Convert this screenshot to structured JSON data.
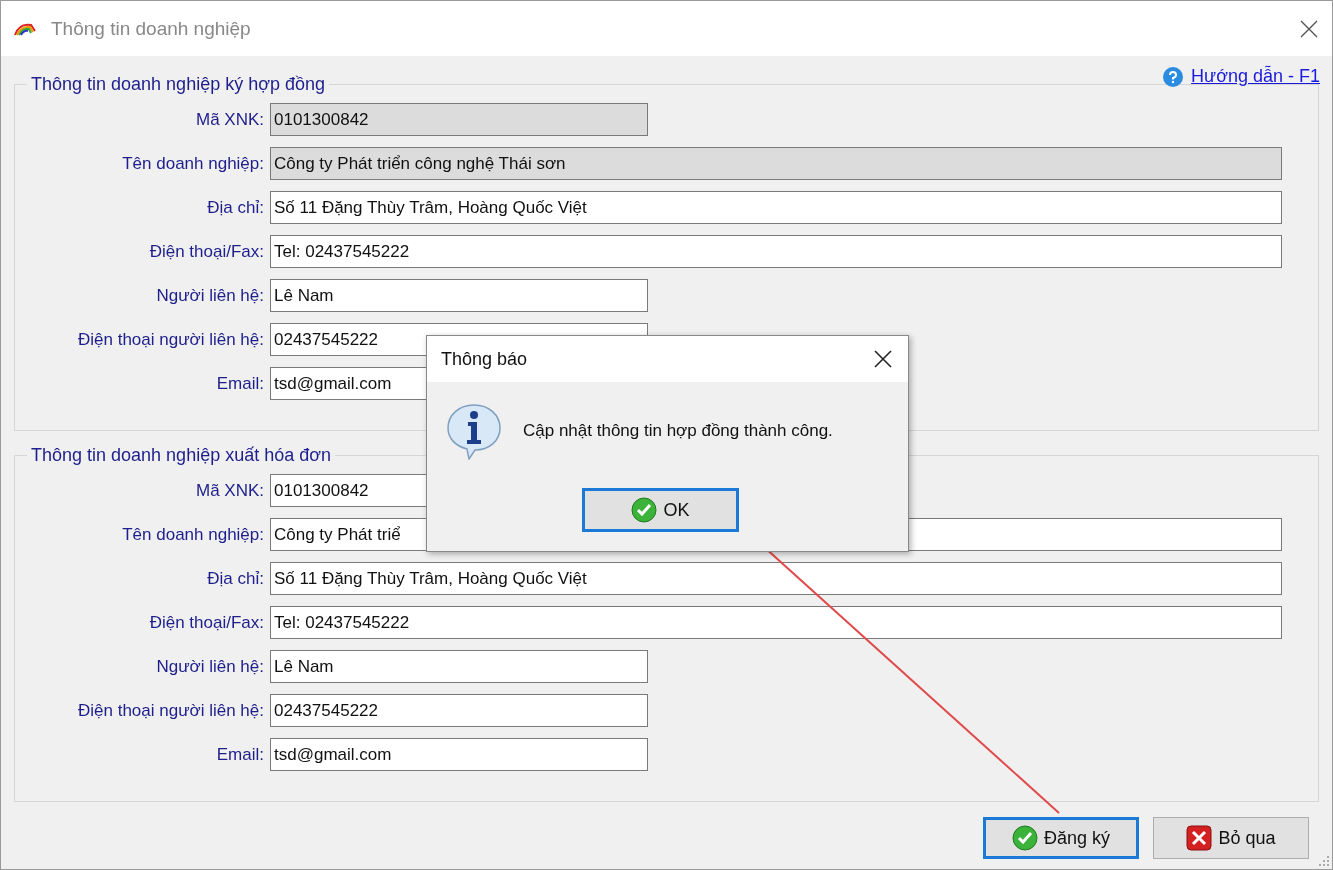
{
  "window": {
    "title": "Thông tin doanh nghiệp"
  },
  "help_link": "Hướng dẫn - F1",
  "groups": [
    {
      "title": "Thông tin doanh nghiệp ký hợp đồng",
      "fields": [
        {
          "label": "Mã XNK:",
          "value": "0101300842",
          "disabled": true
        },
        {
          "label": "Tên doanh nghiệp:",
          "value": "Công ty Phát triển công nghệ Thái sơn",
          "disabled": true
        },
        {
          "label": "Địa chỉ:",
          "value": "Số 11 Đặng Thùy Trâm, Hoàng Quốc Việt",
          "disabled": false
        },
        {
          "label": "Điện thoại/Fax:",
          "value": "Tel: 02437545222",
          "disabled": false
        },
        {
          "label": "Người liên hệ:",
          "value": "Lê Nam",
          "disabled": false
        },
        {
          "label": "Điện thoại người liên hệ:",
          "value": "02437545222",
          "disabled": false
        },
        {
          "label": "Email:",
          "value": "tsd@gmail.com",
          "disabled": false
        }
      ]
    },
    {
      "title": "Thông tin doanh nghiệp xuất hóa đơn",
      "fields": [
        {
          "label": "Mã XNK:",
          "value": "0101300842",
          "disabled": false
        },
        {
          "label": "Tên doanh nghiệp:",
          "value": "Công ty Phát triể",
          "disabled": false
        },
        {
          "label": "Địa chỉ:",
          "value": "Số 11 Đặng Thùy Trâm, Hoàng Quốc Việt",
          "disabled": false
        },
        {
          "label": "Điện thoại/Fax:",
          "value": "Tel: 02437545222",
          "disabled": false
        },
        {
          "label": "Người liên hệ:",
          "value": "Lê Nam",
          "disabled": false
        },
        {
          "label": "Điện thoại người liên hệ:",
          "value": "02437545222",
          "disabled": false
        },
        {
          "label": "Email:",
          "value": "tsd@gmail.com",
          "disabled": false
        }
      ]
    }
  ],
  "buttons": [
    {
      "label": "Đăng ký",
      "kind": "confirm",
      "focused": true
    },
    {
      "label": "Bỏ qua",
      "kind": "cancel",
      "focused": false
    }
  ],
  "dialog": {
    "title": "Thông báo",
    "message": "Cập nhật thông tin hợp đồng thành công.",
    "button": {
      "label": "OK",
      "kind": "confirm",
      "focused": true
    }
  }
}
